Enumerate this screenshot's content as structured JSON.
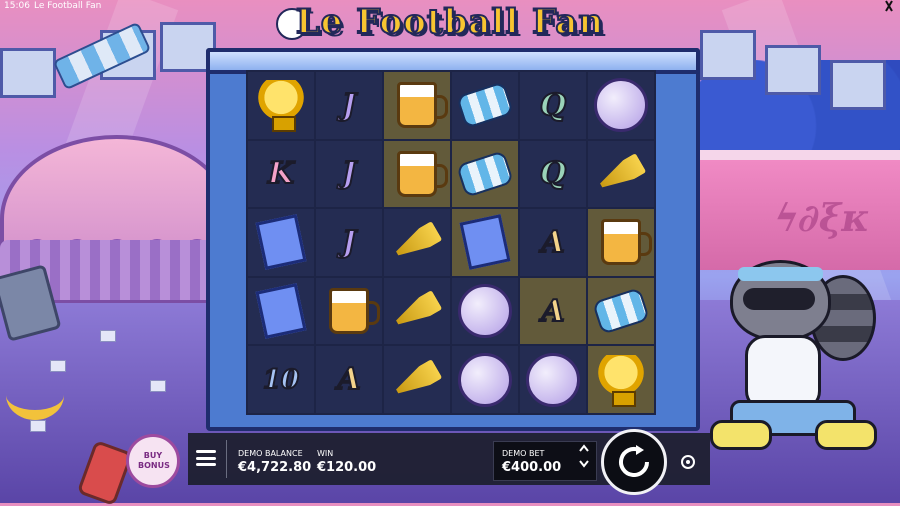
{
  "status_bar": {
    "time": "15:06",
    "app_title": "Le Football Fan",
    "close": "X"
  },
  "game": {
    "logo_text": "Le Football Fan"
  },
  "reels": [
    [
      "trophy",
      "J",
      "beer",
      "scarf",
      "Q",
      "ball"
    ],
    [
      "K",
      "J",
      "beer",
      "scarf",
      "Q",
      "horn"
    ],
    [
      "ticket",
      "J",
      "horn",
      "ticket",
      "A",
      "beer"
    ],
    [
      "ticket",
      "beer",
      "horn",
      "ball",
      "A",
      "scarf"
    ],
    [
      "10",
      "A",
      "horn",
      "ball",
      "ball",
      "trophy"
    ]
  ],
  "highlighted": [
    [
      0,
      2
    ],
    [
      1,
      2
    ],
    [
      1,
      3
    ],
    [
      2,
      3
    ],
    [
      2,
      5
    ],
    [
      3,
      4
    ],
    [
      3,
      5
    ],
    [
      4,
      5
    ]
  ],
  "buy_bonus": {
    "label": "BUY BONUS"
  },
  "controls": {
    "balance_label": "DEMO BALANCE",
    "balance_value": "€4,722.80",
    "win_label": "WIN",
    "win_value": "€120.00",
    "bet_label": "DEMO BET",
    "bet_value": "€400.00"
  },
  "icons": {
    "menu": "hamburger-menu-icon",
    "spin": "spin-arrow-icon",
    "autoplay": "autoplay-icon",
    "bet_up": "chevron-up-icon",
    "bet_down": "chevron-down-icon"
  }
}
